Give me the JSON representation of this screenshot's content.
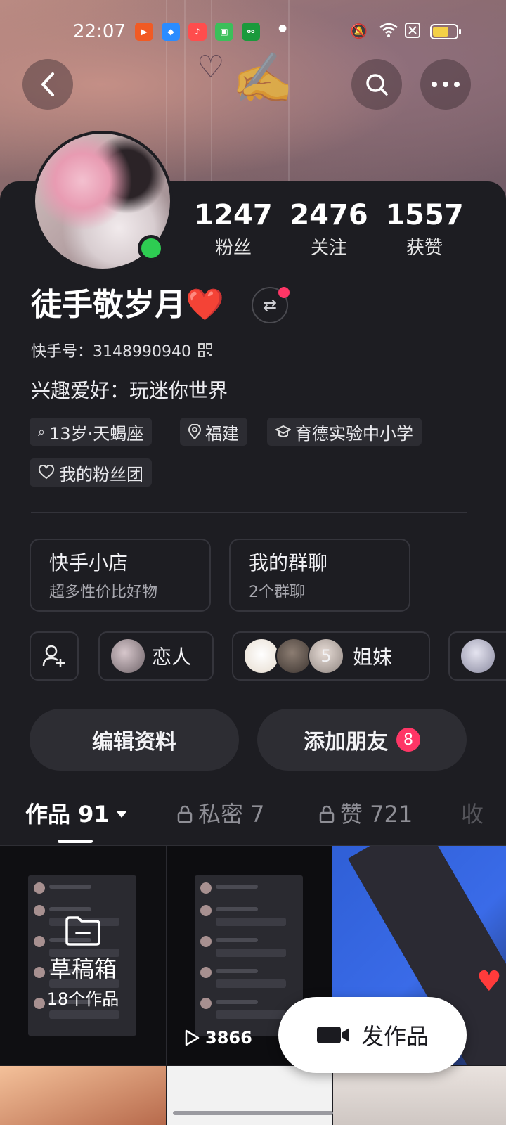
{
  "status_bar": {
    "time": "22:07",
    "apps": [
      "kuaishou-icon",
      "browser-icon",
      "music-icon",
      "market-icon",
      "oppo-icon"
    ]
  },
  "header": {
    "back_icon": "back-arrow-icon",
    "search_icon": "search-icon",
    "more_icon": "more-dots-icon"
  },
  "stats": [
    {
      "value": "1247",
      "label": "粉丝"
    },
    {
      "value": "2476",
      "label": "关注"
    },
    {
      "value": "1557",
      "label": "获赞"
    }
  ],
  "profile": {
    "name": "徒手敬岁月❤️",
    "kuaishou_id": "快手号：3148990940",
    "interest": "兴趣爱好：玩迷你世界"
  },
  "tags": [
    {
      "icon": "search-age-icon",
      "text": "13岁·天蝎座"
    },
    {
      "icon": "location-icon",
      "text": "福建"
    },
    {
      "icon": "school-icon",
      "text": "育德实验中小学"
    },
    {
      "icon": "heart-group-icon",
      "text": "我的粉丝团"
    }
  ],
  "features": [
    {
      "title": "快手小店",
      "subtitle": "超多性价比好物"
    },
    {
      "title": "我的群聊",
      "subtitle": "2个群聊"
    }
  ],
  "relations": [
    {
      "label": "恋人"
    },
    {
      "count": "5",
      "label": "姐妹"
    }
  ],
  "buttons": {
    "edit": "编辑资料",
    "add_friend": "添加朋友",
    "add_friend_badge": "8"
  },
  "tabs": [
    {
      "label": "作品 91"
    },
    {
      "label": "私密 7"
    },
    {
      "label": "赞 721"
    },
    {
      "label": "收"
    }
  ],
  "grid": {
    "draft_title": "草稿箱",
    "draft_count": "18个作品",
    "plays": "3866"
  },
  "publish": {
    "label": "发作品"
  },
  "colors": {
    "background": "#1d1d22",
    "accent": "#fe3666",
    "online": "#2ecc52"
  }
}
